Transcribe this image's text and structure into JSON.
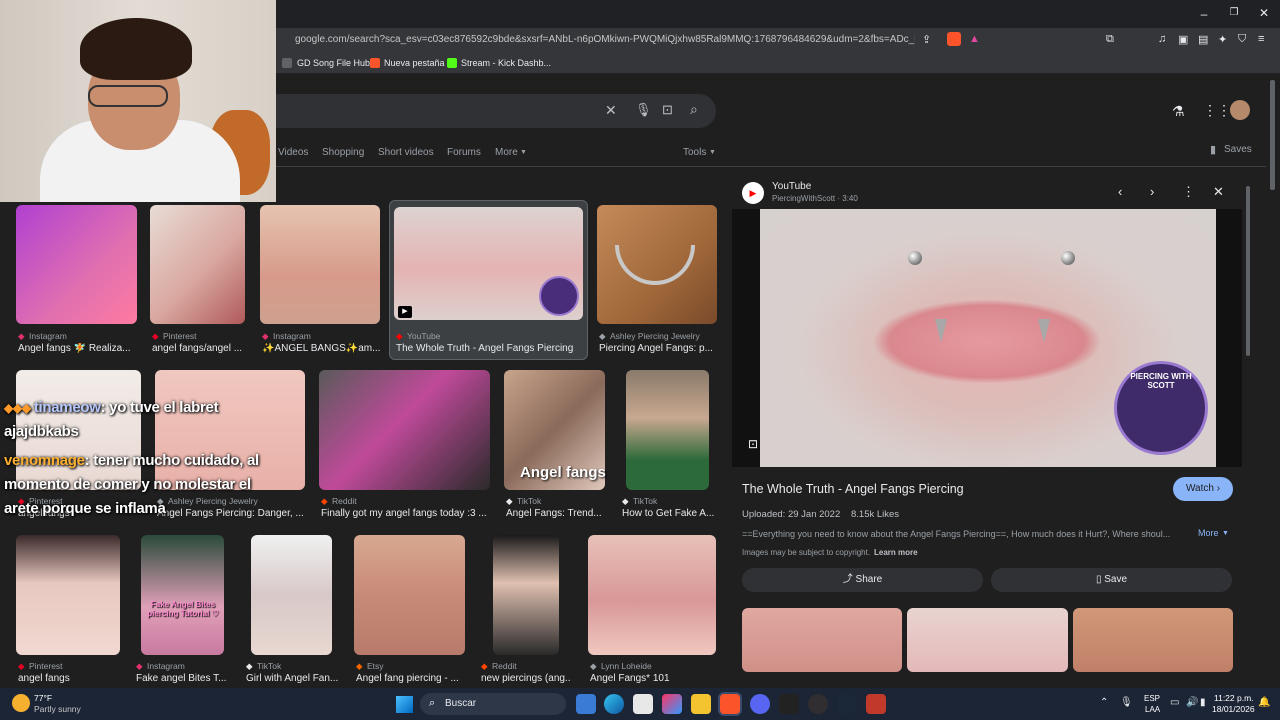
{
  "browser": {
    "url": "google.com/search?sca_esv=c03ec876592c9bde&sxsrf=ANbL-n6pOMkiwn-PWQMiQjxhw85Ral9MMQ:1768796484629&udm=2&fbs=ADc_l-aN0C...",
    "bookmarks": [
      "GD Song File Hub",
      "Nueva pestaña",
      "Stream - Kick Dashb..."
    ]
  },
  "search": {
    "tabs": [
      "Videos",
      "Shopping",
      "Short videos",
      "Forums",
      "More",
      "Tools"
    ],
    "saves_label": "Saves"
  },
  "results": {
    "row1": [
      {
        "source": "Instagram",
        "title": "Angel fangs 🧚 Realiza..."
      },
      {
        "source": "Pinterest",
        "title": "angel fangs/angel ..."
      },
      {
        "source": "Instagram",
        "title": "✨ANGEL BANGS✨am..."
      },
      {
        "source": "YouTube",
        "title": "The Whole Truth - Angel Fangs Piercing"
      },
      {
        "source": "Ashley Piercing Jewelry",
        "title": "Piercing Angel Fangs: p..."
      }
    ],
    "row2": [
      {
        "source": "Pinterest",
        "title": "angel fangs"
      },
      {
        "source": "Ashley Piercing Jewelry",
        "title": "Angel Fangs Piercing: Danger, ..."
      },
      {
        "source": "Reddit",
        "title": "Finally got my angel fangs today :3 ..."
      },
      {
        "source": "TikTok",
        "title": "Angel Fangs: Trend..."
      },
      {
        "source": "TikTok",
        "title": "How to Get Fake A..."
      }
    ],
    "row3": [
      {
        "source": "Pinterest",
        "title": "angel fangs"
      },
      {
        "source": "Instagram",
        "title": "Fake angel Bites T..."
      },
      {
        "source": "TikTok",
        "title": "Girl with Angel Fan..."
      },
      {
        "source": "Etsy",
        "title": "Angel fang piercing - ..."
      },
      {
        "source": "Reddit",
        "title": "new piercings (ang..."
      },
      {
        "source": "Lynn Loheide",
        "title": "Angel Fangs* 101"
      }
    ],
    "overlay_text": {
      "angel_fangs": "Angel fangs",
      "fake_tutorial": "Fake Angel Bites piercing Tutorial ♡"
    }
  },
  "chat": {
    "line1_user": "tinameow",
    "line1_text": ": yo tuve el labret",
    "line2": "ajajdbkabs",
    "line3_user": "venomnage",
    "line3_text": ": tener mucho cuidado, al",
    "line4": "momento de comer y no molestar el",
    "line5": "arete porque se inflama"
  },
  "panel": {
    "site": "YouTube",
    "channel": "PiercingWithScott · 3:40",
    "title": "The Whole Truth - Angel Fangs Piercing",
    "watch_label": "Watch",
    "uploaded": "Uploaded: 29 Jan 2022",
    "likes": "8.15k Likes",
    "description": "==Everything you need to know about the Angel Fangs Piercing==, How much does it Hurt?, Where shoul...",
    "more_label": "More",
    "copyright": "Images may be subject to copyright.",
    "learn_more": "Learn more",
    "share_label": "Share",
    "save_label": "Save",
    "logo_text": "PIERCING WITH SCOTT"
  },
  "taskbar": {
    "temp": "77°F",
    "weather": "Partly sunny",
    "search_label": "Buscar",
    "lang1": "ESP",
    "lang2": "LAA",
    "time": "11:22 p.m.",
    "date": "18/01/2026"
  },
  "colors": {
    "accent_blue": "#8ab4f8",
    "watch_bg": "#8ab4f8",
    "bg": "#1f1f1f"
  }
}
